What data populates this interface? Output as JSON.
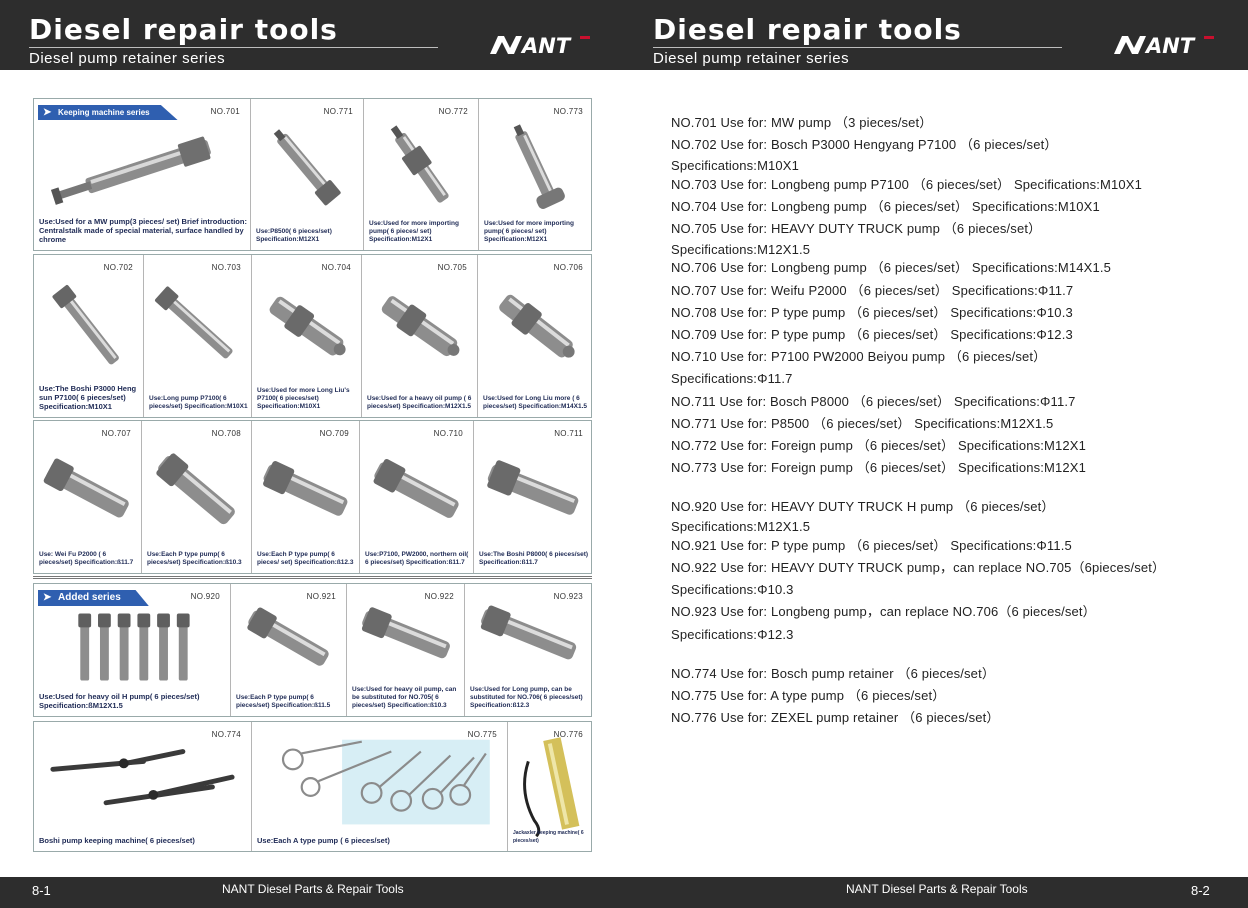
{
  "header": {
    "left_title": "Diesel repair tools",
    "left_subtitle": "Diesel pump retainer series",
    "right_title": "Diesel repair tools",
    "right_subtitle": "Diesel pump retainer series",
    "logo_text": "NANT"
  },
  "footer": {
    "left_page": "8-1",
    "left_text": "NANT Diesel Parts & Repair Tools",
    "right_text": "NANT Diesel Parts & Repair Tools",
    "right_page": "8-2"
  },
  "catalog": {
    "banner_keeping": "Keeping machine series",
    "banner_added": "Added series",
    "rows": [
      [
        {
          "no": "NO.701",
          "caption": "Use:Used for a MW pump(3 pieces/ set) Brief introduction: Centralstalk made of special material, surface handled by chrome"
        },
        {
          "no": "NO.771",
          "caption": "Use:P8500( 6 pieces/set) Specification:M12X1"
        },
        {
          "no": "NO.772",
          "caption": "Use:Used for more importing pump( 6 pieces/ set) Specification:M12X1"
        },
        {
          "no": "NO.773",
          "caption": "Use:Used for more importing pump( 6 pieces/ set) Specification:M12X1"
        }
      ],
      [
        {
          "no": "NO.702",
          "caption": "Use:The Boshi P3000 Heng sun P7100( 6 pieces/set) Specification:M10X1"
        },
        {
          "no": "NO.703",
          "caption": "Use:Long pump P7100( 6 pieces/set) Specification:M10X1"
        },
        {
          "no": "NO.704",
          "caption": "Use:Used for more Long Liu's P7100( 6 pieces/set) Specification:M10X1"
        },
        {
          "no": "NO.705",
          "caption": "Use:Used for a heavy oil pump ( 6 pieces/set) Specification:M12X1.5"
        },
        {
          "no": "NO.706",
          "caption": "Use:Used for Long Liu more ( 6 pieces/set) Specification:M14X1.5"
        }
      ],
      [
        {
          "no": "NO.707",
          "caption": "Use: Wei Fu P2000 ( 6 pieces/set) Specification:ß11.7"
        },
        {
          "no": "NO.708",
          "caption": "Use:Each P type pump( 6 pieces/set) Specification:ß10.3"
        },
        {
          "no": "NO.709",
          "caption": "Use:Each P type pump( 6 pieces/ set) Specification:ß12.3"
        },
        {
          "no": "NO.710",
          "caption": "Use:P7100, PW2000, northern oil( 6 pieces/set) Specification:ß11.7"
        },
        {
          "no": "NO.711",
          "caption": "Use:The Boshi P8000( 6 pieces/set) Specification:ß11.7"
        }
      ],
      [
        {
          "no": "NO.920",
          "caption": "Use:Used for heavy oil H pump( 6 pieces/set) Specification:ßM12X1.5"
        },
        {
          "no": "NO.921",
          "caption": "Use:Each P type pump( 6 pieces/set) Specification:ß11.5"
        },
        {
          "no": "NO.922",
          "caption": "Use:Used for heavy oil pump, can be substituted for NO.705( 6 pieces/set) Specification:ß10.3"
        },
        {
          "no": "NO.923",
          "caption": "Use:Used for Long pump, can be substituted for NO.706( 6 pieces/set) Specification:ß12.3"
        }
      ],
      [
        {
          "no": "NO.774",
          "caption": "Boshi pump keeping machine( 6 pieces/set)"
        },
        {
          "no": "NO.775",
          "caption": "Use:Each A type pump ( 6 pieces/set)"
        },
        {
          "no": "NO.776",
          "caption": "Jackaxler keeping machine( 6 pieces/set)"
        }
      ]
    ]
  },
  "specs": [
    "NO.701  Use for: MW pump （3 pieces/set）",
    "NO.702  Use for: Bosch P3000  Hengyang P7100 （6 pieces/set）",
    "Specifications:M10X1",
    "NO.703  Use for: Longbeng pump P7100 （6 pieces/set）  Specifications:M10X1",
    "NO.704  Use for: Longbeng pump （6 pieces/set）  Specifications:M10X1",
    "NO.705  Use for: HEAVY DUTY TRUCK pump （6 pieces/set）",
    "Specifications:M12X1.5",
    "NO.706  Use for: Longbeng pump （6 pieces/set）  Specifications:M14X1.5",
    "NO.707  Use for: Weifu P2000  （6 pieces/set）  Specifications:Φ11.7",
    "NO.708  Use for: P type pump  （6 pieces/set）  Specifications:Φ10.3",
    "NO.709  Use for: P type pump  （6 pieces/set）  Specifications:Φ12.3",
    "NO.710  Use for: P7100 PW2000 Beiyou pump （6 pieces/set）",
    "Specifications:Φ11.7",
    "NO.711  Use for: Bosch P8000  （6 pieces/set）  Specifications:Φ11.7",
    "NO.771  Use for: P8500  （6 pieces/set）  Specifications:M12X1.5",
    "NO.772  Use for: Foreign pump （6 pieces/set）  Specifications:M12X1",
    "NO.773  Use for: Foreign pump （6 pieces/set）  Specifications:M12X1",
    "NO.920  Use for: HEAVY DUTY TRUCK H pump （6 pieces/set）",
    "Specifications:M12X1.5",
    "NO.921  Use for: P type pump  （6 pieces/set）  Specifications:Φ11.5",
    "NO.922  Use for: HEAVY DUTY TRUCK pump，can replace NO.705（6pieces/set）",
    "Specifications:Φ10.3",
    "NO.923  Use for: Longbeng pump，can replace NO.706（6 pieces/set）",
    "Specifications:Φ12.3",
    "NO.774  Use for:  Bosch pump retainer （6 pieces/set）",
    "NO.775  Use for: A type pump  （6 pieces/set）",
    "NO.776  Use for:  ZEXEL pump retainer （6 pieces/set）"
  ]
}
